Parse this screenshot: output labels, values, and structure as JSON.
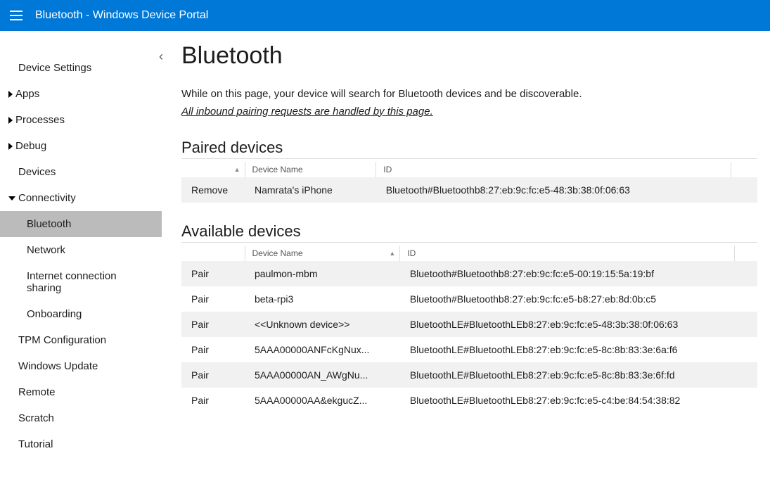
{
  "header": {
    "title": "Bluetooth - Windows Device Portal"
  },
  "sidebar": {
    "items": [
      {
        "label": "Device Settings",
        "caret": "none"
      },
      {
        "label": "Apps",
        "caret": "right"
      },
      {
        "label": "Processes",
        "caret": "right"
      },
      {
        "label": "Debug",
        "caret": "right"
      },
      {
        "label": "Devices",
        "caret": "none"
      },
      {
        "label": "Connectivity",
        "caret": "down",
        "children": [
          {
            "label": "Bluetooth",
            "active": true
          },
          {
            "label": "Network"
          },
          {
            "label": "Internet connection sharing"
          },
          {
            "label": "Onboarding"
          }
        ]
      },
      {
        "label": "TPM Configuration",
        "caret": "none"
      },
      {
        "label": "Windows Update",
        "caret": "none"
      },
      {
        "label": "Remote",
        "caret": "none"
      },
      {
        "label": "Scratch",
        "caret": "none"
      },
      {
        "label": "Tutorial",
        "caret": "none"
      }
    ]
  },
  "main": {
    "title": "Bluetooth",
    "desc": "While on this page, your device will search for Bluetooth devices and be discoverable.",
    "note": "All inbound pairing requests are handled by this page.",
    "paired": {
      "title": "Paired devices",
      "action_label": "Remove",
      "columns": {
        "name": "Device Name",
        "id": "ID"
      },
      "rows": [
        {
          "name": "Namrata's iPhone",
          "id": "Bluetooth#Bluetoothb8:27:eb:9c:fc:e5-48:3b:38:0f:06:63"
        }
      ]
    },
    "available": {
      "title": "Available devices",
      "action_label": "Pair",
      "columns": {
        "name": "Device Name",
        "id": "ID"
      },
      "rows": [
        {
          "name": "paulmon-mbm",
          "id": "Bluetooth#Bluetoothb8:27:eb:9c:fc:e5-00:19:15:5a:19:bf"
        },
        {
          "name": "beta-rpi3",
          "id": "Bluetooth#Bluetoothb8:27:eb:9c:fc:e5-b8:27:eb:8d:0b:c5"
        },
        {
          "name": "<<Unknown device>>",
          "id": "BluetoothLE#BluetoothLEb8:27:eb:9c:fc:e5-48:3b:38:0f:06:63"
        },
        {
          "name": "5AAA00000ANFcKgNux...",
          "id": "BluetoothLE#BluetoothLEb8:27:eb:9c:fc:e5-8c:8b:83:3e:6a:f6"
        },
        {
          "name": "5AAA00000AN_AWgNu...",
          "id": "BluetoothLE#BluetoothLEb8:27:eb:9c:fc:e5-8c:8b:83:3e:6f:fd"
        },
        {
          "name": "5AAA00000AA&ekgucZ...",
          "id": "BluetoothLE#BluetoothLEb8:27:eb:9c:fc:e5-c4:be:84:54:38:82"
        }
      ]
    }
  }
}
